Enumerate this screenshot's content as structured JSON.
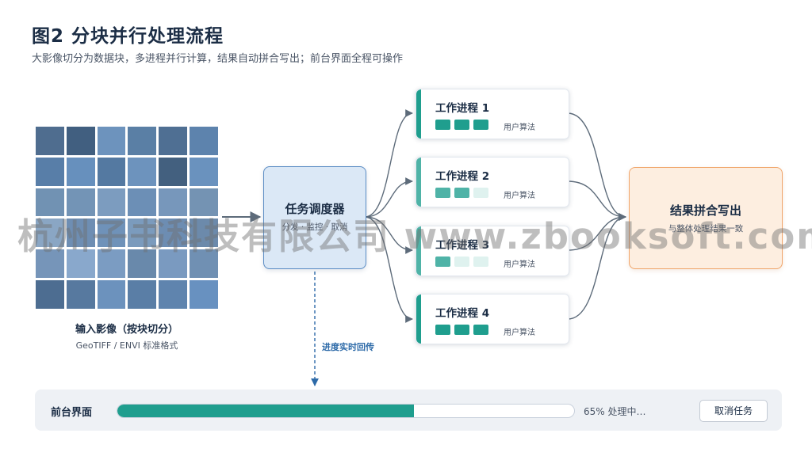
{
  "title": "图2 分块并行处理流程",
  "subtitle": "大影像切分为数据块，多进程并行计算，结果自动拼合写出；前台界面全程可操作",
  "input": {
    "title": "输入影像（按块切分）",
    "subtitle": "GeoTIFF / ENVI 标准格式",
    "tile_colors": [
      [
        "#4f6d8f",
        "#415f80",
        "#6d93bd",
        "#5a7fa5",
        "#4f6f93",
        "#5d83ad"
      ],
      [
        "#587ea8",
        "#6790bd",
        "#5479a1",
        "#6d93bd",
        "#43607f",
        "#6a92be"
      ],
      [
        "#7192b3",
        "#7394b6",
        "#7c9cbf",
        "#6c8fb6",
        "#7797bb",
        "#7493b3"
      ],
      [
        "#8aa6c4",
        "#6e8eb3",
        "#6f92b9",
        "#7b9bbd",
        "#6d8db2",
        "#6c8aab"
      ],
      [
        "#7695b9",
        "#89a8cc",
        "#7b9cc2",
        "#6989ab",
        "#7a9ac0",
        "#7090b3"
      ],
      [
        "#4d6d91",
        "#57799f",
        "#6c92bd",
        "#5a7ea6",
        "#5f84ae",
        "#6891c0"
      ]
    ]
  },
  "scheduler": {
    "title": "任务调度器",
    "subtitle": "分发 · 监控 · 取消"
  },
  "workers": [
    {
      "title": "工作进程 1",
      "algorithm": "用户算法",
      "bar_color": "#1f9e8e",
      "chips": [
        "#1f9e8e",
        "#1f9e8e",
        "#1f9e8e"
      ]
    },
    {
      "title": "工作进程 2",
      "algorithm": "用户算法",
      "bar_color": "#4fb3a7",
      "chips": [
        "#4fb3a7",
        "#4fb3a7",
        "#dff2ef"
      ]
    },
    {
      "title": "工作进程 3",
      "algorithm": "用户算法",
      "bar_color": "#4fb3a7",
      "chips": [
        "#4fb3a7",
        "#dff2ef",
        "#dff2ef"
      ]
    },
    {
      "title": "工作进程 4",
      "algorithm": "用户算法",
      "bar_color": "#1f9e8e",
      "chips": [
        "#1f9e8e",
        "#1f9e8e",
        "#1f9e8e"
      ]
    }
  ],
  "merge": {
    "title": "结果拼合写出",
    "subtitle": "与整体处理结果一致"
  },
  "progress_link_label": "进度实时回传",
  "ui_panel": {
    "title": "前台界面",
    "progress_fraction": 0.65,
    "progress_text": "65% 处理中…",
    "cancel_label": "取消任务"
  },
  "watermark": "杭州子书科技有限公司 www.zbooksoft.com",
  "colors": {
    "teal": "#1f9e8e",
    "scheduler_fill": "#dbe8f6",
    "scheduler_border": "#5a8cc4",
    "merge_fill": "#fdeee0",
    "merge_border": "#f0a56a",
    "link": "#5d6b7a",
    "dashed_link": "#2d6aa8"
  }
}
